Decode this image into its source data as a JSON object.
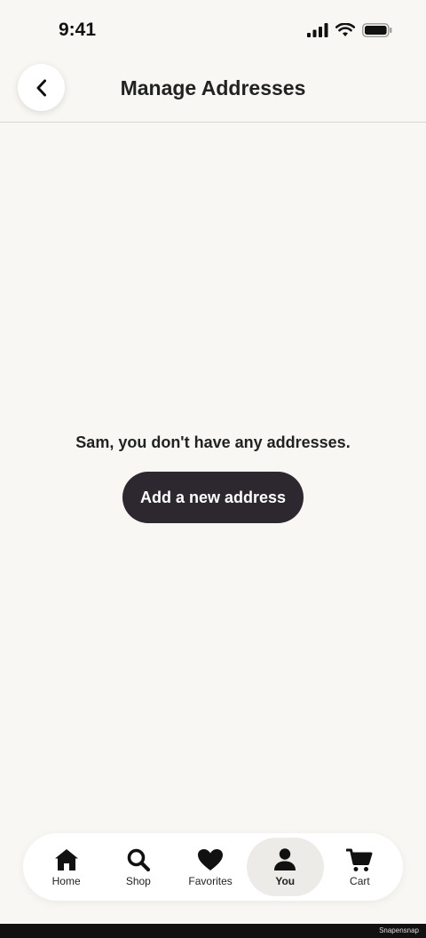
{
  "status_bar": {
    "time": "9:41"
  },
  "header": {
    "title": "Manage Addresses"
  },
  "main": {
    "empty_message": "Sam, you don't have any addresses.",
    "add_button_label": "Add a new address"
  },
  "tab_bar": {
    "items": [
      {
        "label": "Home",
        "icon": "home-icon"
      },
      {
        "label": "Shop",
        "icon": "search-icon"
      },
      {
        "label": "Favorites",
        "icon": "heart-icon"
      },
      {
        "label": "You",
        "icon": "user-icon",
        "active": true
      },
      {
        "label": "Cart",
        "icon": "cart-icon"
      }
    ]
  },
  "footer": {
    "watermark": "Snapensnap"
  },
  "colors": {
    "background": "#f8f7f3",
    "primary_button": "#2d2730",
    "active_tab": "#ecebe8"
  }
}
